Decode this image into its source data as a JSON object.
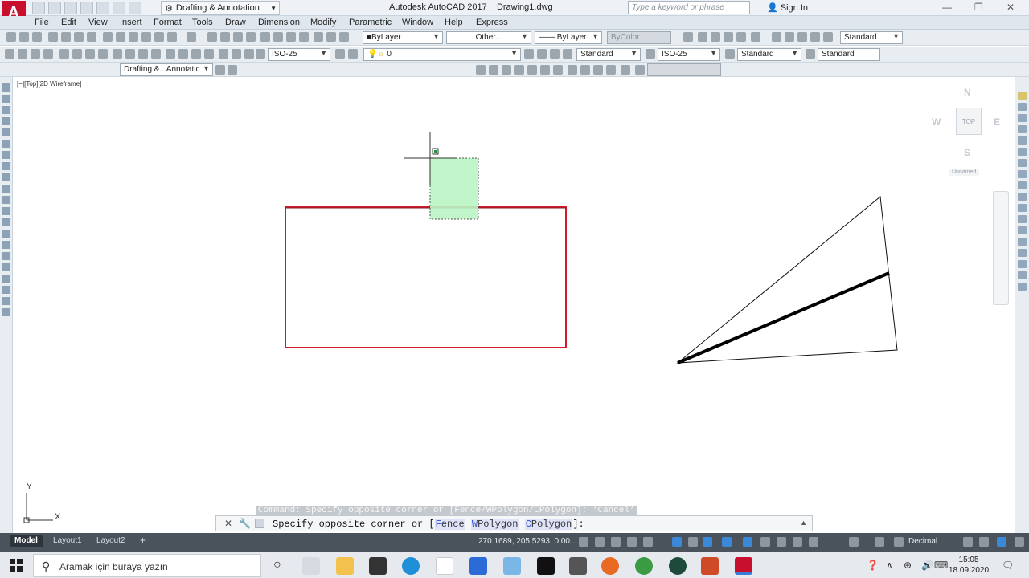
{
  "app": {
    "logo": "A",
    "title": "Autodesk AutoCAD 2017",
    "document": "Drawing1.dwg",
    "workspace": "Drafting & Annotation",
    "search_placeholder": "Type a keyword or phrase",
    "signin": "Sign In"
  },
  "menu": [
    "File",
    "Edit",
    "View",
    "Insert",
    "Format",
    "Tools",
    "Draw",
    "Dimension",
    "Modify",
    "Parametric",
    "Window",
    "Help",
    "Express"
  ],
  "properties": {
    "color": "ByLayer",
    "linetype": "Other...",
    "lineweight": "ByLayer",
    "plotstyle": "ByColor",
    "style": "Standard"
  },
  "dimtoolbar": {
    "dimstyle": "ISO-25",
    "layer": "0",
    "textstyle": "Standard",
    "dimstyle2": "ISO-25",
    "tablestyle": "Standard",
    "mleaderstyle": "Standard"
  },
  "workspace_toolbar": "Drafting &...Annotatic",
  "viewport": {
    "label": "[−][Top][2D Wireframe]",
    "viewcube": {
      "face": "TOP",
      "n": "N",
      "s": "S",
      "e": "E",
      "w": "W",
      "ucs": "Unnamed"
    },
    "ucs": {
      "x": "X",
      "y": "Y"
    }
  },
  "command": {
    "history": "Command: Specify opposite corner or [Fence/WPolygon/CPolygon]: *Cancel*",
    "prompt_prefix": "Specify opposite corner or [",
    "opt1_key": "F",
    "opt1_rest": "ence",
    "opt2_key": "W",
    "opt2_rest": "Polygon",
    "opt3_key": "C",
    "opt3_rest": "Polygon",
    "prompt_suffix": "]:",
    "close": "✕",
    "customize": "🔧"
  },
  "tabs": [
    "Model",
    "Layout1",
    "Layout2"
  ],
  "add_tab": "+",
  "status": {
    "coords": "270.1689, 205.5293, 0.00...",
    "units": "Decimal"
  },
  "taskbar": {
    "search": "Aramak için buraya yazın",
    "time": "15:05",
    "date": "18.09.2020"
  },
  "colors": {
    "accent": "#c8102e",
    "selection_fill": "#b9f5c4",
    "highlight_red": "#d11a2a",
    "status_bg": "#4a535c"
  }
}
